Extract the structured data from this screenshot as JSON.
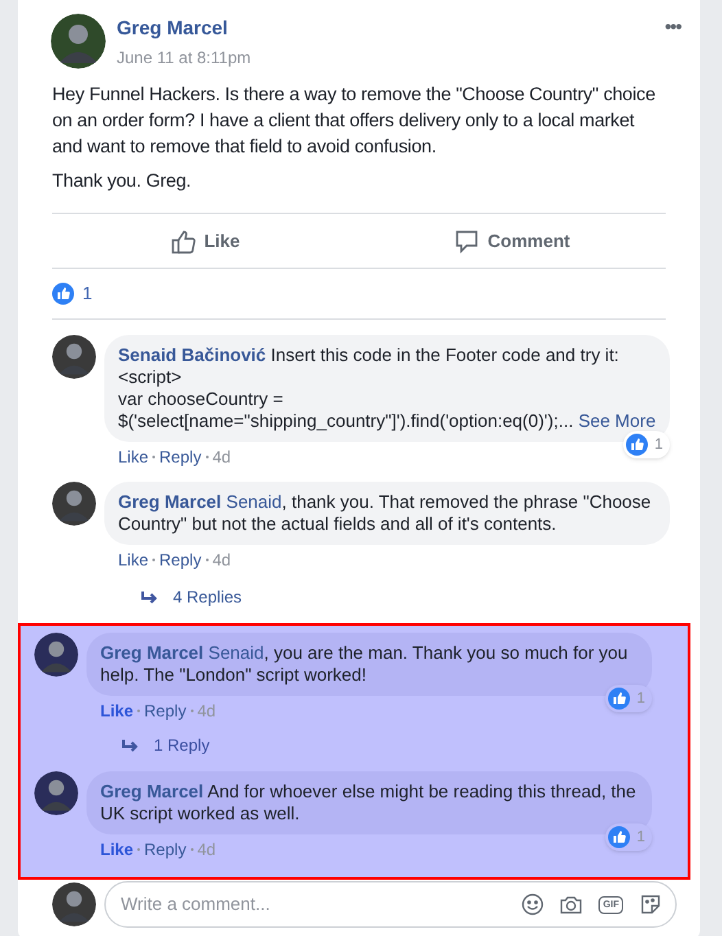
{
  "post": {
    "author": "Greg Marcel",
    "time": "June 11 at 8:11pm",
    "menu": "•••",
    "paragraphs": [
      "Hey Funnel Hackers. Is there a way to remove the \"Choose Country\" choice on an order form? I have a client that offers delivery only to a local market and want to remove that field to avoid confusion.",
      "Thank you. Greg."
    ]
  },
  "actions": [
    {
      "kind": "like",
      "label": "Like"
    },
    {
      "kind": "comment",
      "label": "Comment"
    }
  ],
  "reactions": {
    "count": "1"
  },
  "thread": [
    {
      "kind": "comment",
      "highlighted": false,
      "author": "Senaid Bačinović",
      "text": "Insert this code in the Footer code and try it:\n<script>\nvar chooseCountry =\n$('select[name=\"shipping_country\"]').find('option:eq(0)');...",
      "see_more": "See More",
      "like": "Like",
      "liked": false,
      "reply": "Reply",
      "age": "4d",
      "reactions": "1"
    },
    {
      "kind": "comment",
      "highlighted": false,
      "author": "Greg Marcel",
      "mention": "Senaid",
      "text": ", thank you. That removed the phrase \"Choose Country\" but not the actual fields and all of it's contents.",
      "like": "Like",
      "liked": false,
      "reply": "Reply",
      "age": "4d"
    },
    {
      "kind": "replies",
      "highlighted": false,
      "label": "4 Replies"
    },
    {
      "kind": "comment",
      "highlighted": true,
      "author": "Greg Marcel",
      "mention": "Senaid",
      "text": ", you are the man. Thank you so much for you help. The \"London\" script worked!",
      "like": "Like",
      "liked": true,
      "reply": "Reply",
      "age": "4d",
      "reactions": "1"
    },
    {
      "kind": "replies",
      "highlighted": true,
      "label": "1 Reply"
    },
    {
      "kind": "comment",
      "highlighted": true,
      "author": "Greg Marcel",
      "text": "And for whoever else might be reading this thread, the UK script worked as well.",
      "like": "Like",
      "liked": true,
      "reply": "Reply",
      "age": "4d",
      "reactions": "1"
    }
  ],
  "composer": {
    "placeholder": "Write a comment...",
    "gif_label": "GIF"
  }
}
